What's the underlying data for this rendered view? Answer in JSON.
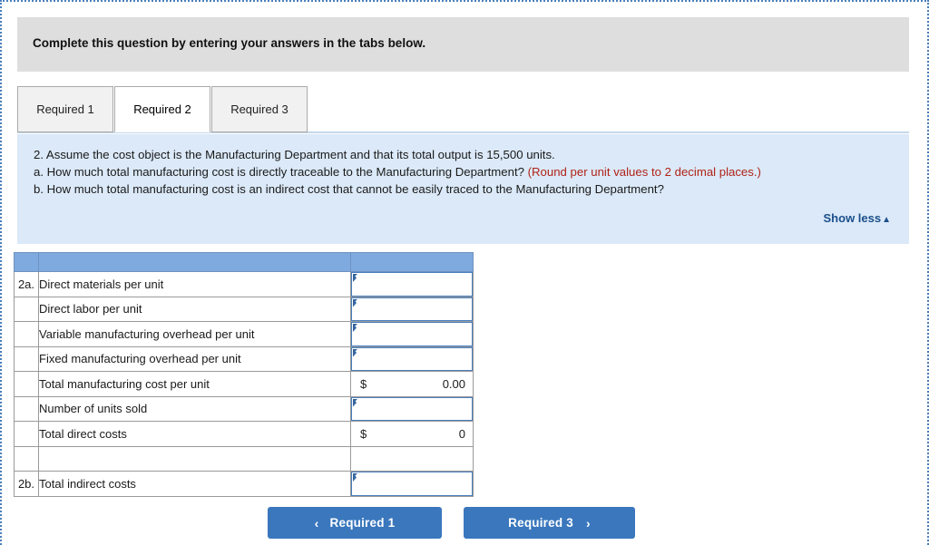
{
  "instruction": {
    "text": "Complete this question by entering your answers in the tabs below."
  },
  "tabs": [
    {
      "label": "Required 1",
      "active": false
    },
    {
      "label": "Required 2",
      "active": true
    },
    {
      "label": "Required 3",
      "active": false
    }
  ],
  "question": {
    "line1": "2. Assume the cost object is the Manufacturing Department and that its total output is 15,500 units.",
    "line2a_black": "a. How much total manufacturing cost is directly traceable to the Manufacturing Department? ",
    "line2a_red": "(Round per unit values to 2 decimal places.)",
    "line2b": "b. How much total manufacturing cost is an indirect cost that cannot be easily traced to the Manufacturing Department?",
    "show_less_label": "Show less",
    "show_less_caret": "▲"
  },
  "worksheet": {
    "header": {
      "ref": "",
      "label": "",
      "value": ""
    },
    "rows": [
      {
        "ref": "2a.",
        "label": "Direct materials per unit",
        "kind": "entry",
        "symbol": "",
        "value": ""
      },
      {
        "ref": "",
        "label": "Direct labor per unit",
        "kind": "entry",
        "symbol": "",
        "value": ""
      },
      {
        "ref": "",
        "label": "Variable manufacturing overhead per unit",
        "kind": "entry",
        "symbol": "",
        "value": ""
      },
      {
        "ref": "",
        "label": "Fixed manufacturing overhead per unit",
        "kind": "entry",
        "symbol": "",
        "value": ""
      },
      {
        "ref": "",
        "label": "Total manufacturing cost per unit",
        "kind": "money",
        "symbol": "$",
        "value": "0.00"
      },
      {
        "ref": "",
        "label": "Number of units sold",
        "kind": "entry",
        "symbol": "",
        "value": ""
      },
      {
        "ref": "",
        "label": "Total direct costs",
        "kind": "money",
        "symbol": "$",
        "value": "0"
      },
      {
        "ref": "",
        "label": "",
        "kind": "blank",
        "symbol": "",
        "value": ""
      },
      {
        "ref": "2b.",
        "label": "Total indirect costs",
        "kind": "entry",
        "symbol": "",
        "value": ""
      }
    ]
  },
  "nav": {
    "prev_label": "Required 1",
    "prev_chevron": "‹",
    "next_label": "Required 3",
    "next_chevron": "›"
  },
  "colors": {
    "banner_grey": "#dededf",
    "panel_blue": "#dbe9f8",
    "table_header_blue": "#7eaae0",
    "entry_border_blue": "#4a7fbe",
    "button_blue": "#3a77bd",
    "red_text": "#b12318",
    "link_blue": "#1c4f8b",
    "frame_dotted_blue": "#4a7ebb"
  }
}
